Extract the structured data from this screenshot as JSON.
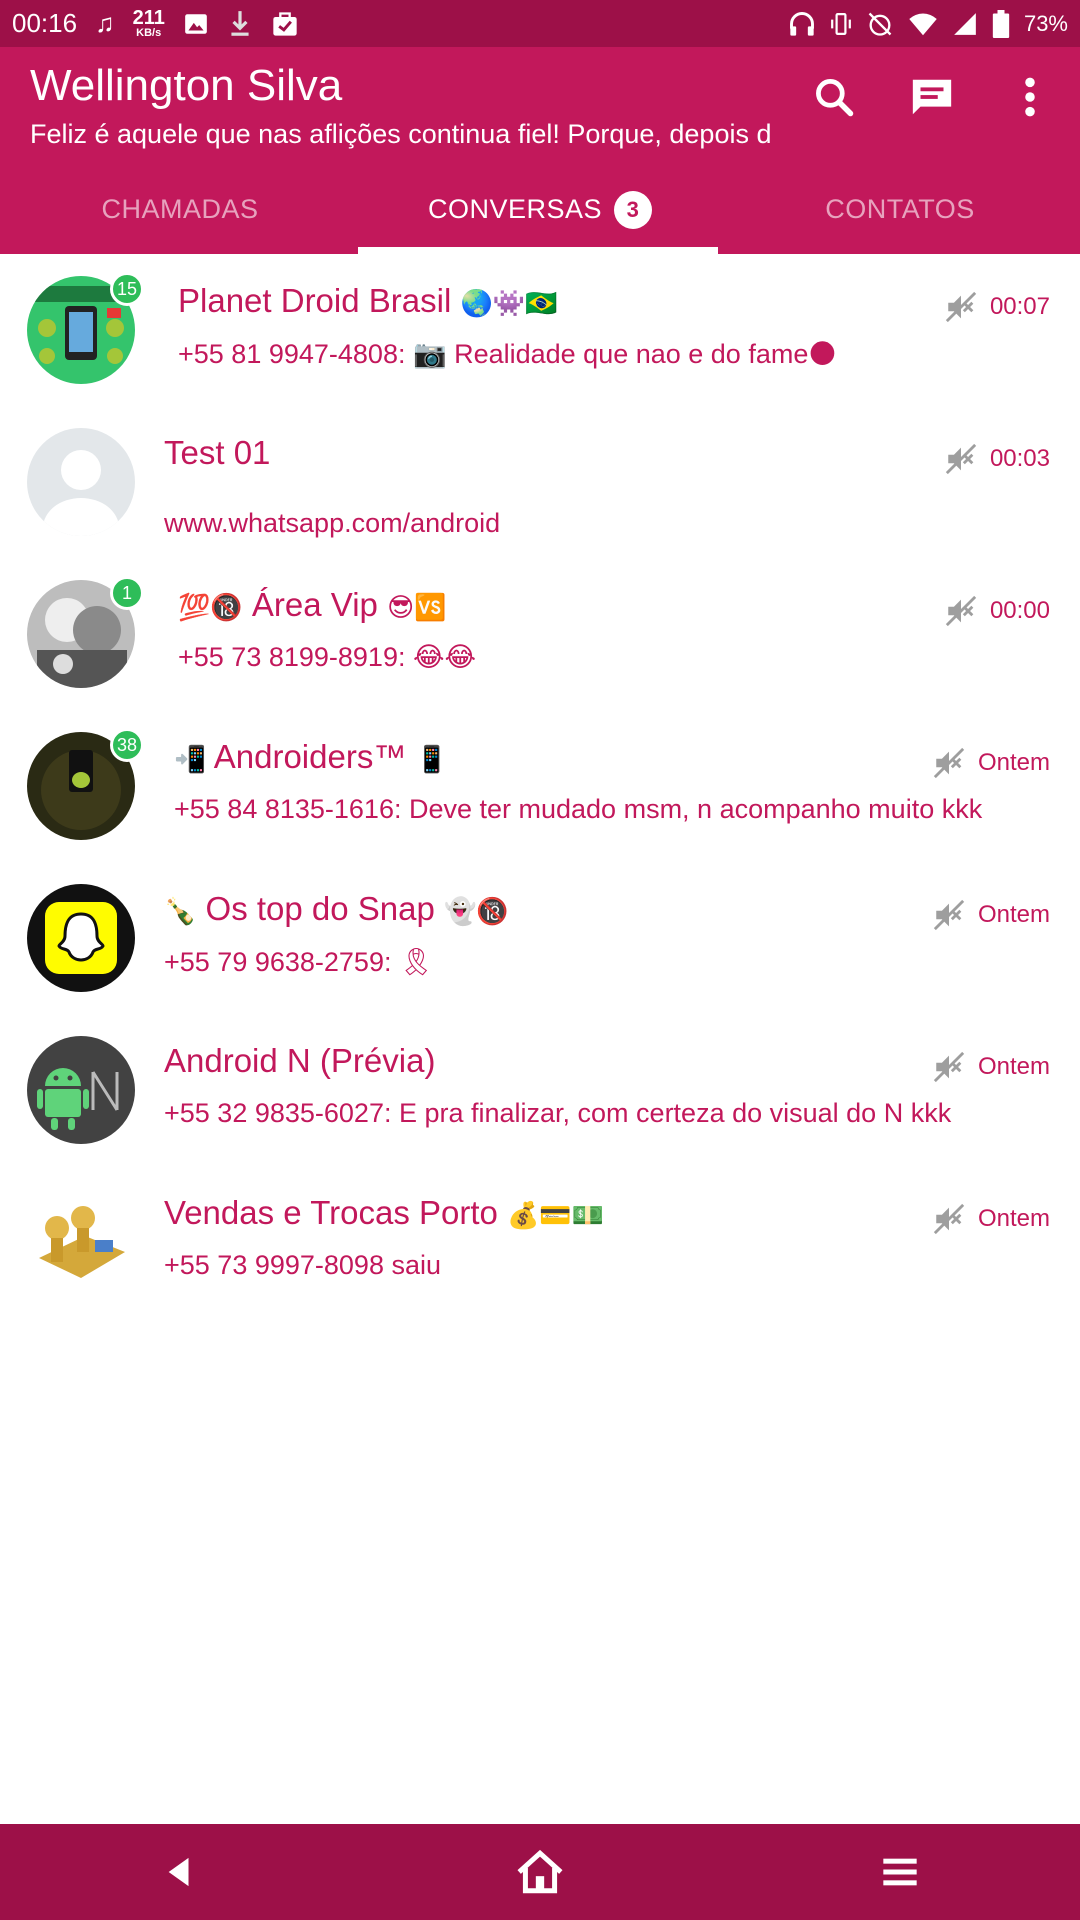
{
  "status_bar": {
    "time": "00:16",
    "net_speed_value": "211",
    "net_speed_unit": "KB/s",
    "battery": "73%"
  },
  "app": {
    "title": "Wellington Silva",
    "subtitle": "Feliz é aquele que nas aflições continua fiel! Porque, depois d..."
  },
  "tabs": [
    {
      "label": "CHAMADAS"
    },
    {
      "label": "CONVERSAS",
      "badge": "3"
    },
    {
      "label": "CONTATOS"
    }
  ],
  "chats": [
    {
      "name": "Planet Droid Brasil",
      "name_emoji": "🌏👾🇧🇷",
      "preview": "+55 81 9947-4808: 📷 Realidade que nao e do fame🌑",
      "time": "00:07",
      "unread": "15"
    },
    {
      "name": "Test 01",
      "name_emoji": "",
      "preview": "www.whatsapp.com/android",
      "time": "00:03",
      "unread": ""
    },
    {
      "name": "Área Vip",
      "name_emoji": "💯🔞",
      "name_emoji_after": "😎🆚",
      "preview": "+55 73 8199-8919: 😂😂",
      "time": "00:00",
      "unread": "1"
    },
    {
      "name": "Androiders™",
      "name_emoji": "📲",
      "name_emoji_after": "📱",
      "preview": "+55 84 8135-1616: Deve ter mudado msm, n acompanho muito kkk",
      "time": "Ontem",
      "unread": "38"
    },
    {
      "name": "Os top do Snap",
      "name_emoji": "🍾",
      "name_emoji_after": "👻🔞",
      "preview": "+55 79 9638-2759: 🎗",
      "time": "Ontem",
      "unread": ""
    },
    {
      "name": "Android N (Prévia)",
      "name_emoji": "",
      "preview": "+55 32 9835-6027: E pra finalizar, com certeza do visual do N kkk",
      "time": "Ontem",
      "unread": ""
    },
    {
      "name": "Vendas e Trocas Porto",
      "name_emoji": "",
      "name_emoji_after": "💰💳💵",
      "preview": "+55 73 9997-8098 saiu",
      "time": "Ontem",
      "unread": ""
    }
  ],
  "colors": {
    "status_bar": "#9d1048",
    "app_bar": "#c2185b",
    "accent_text": "#c2185b",
    "unread_badge": "#2ebd59"
  },
  "icons": {
    "search": "search-icon",
    "new_chat": "message-icon",
    "more": "more-vert-icon",
    "mute": "mute-icon",
    "back": "back-icon",
    "home": "home-icon",
    "menu": "menu-icon"
  }
}
